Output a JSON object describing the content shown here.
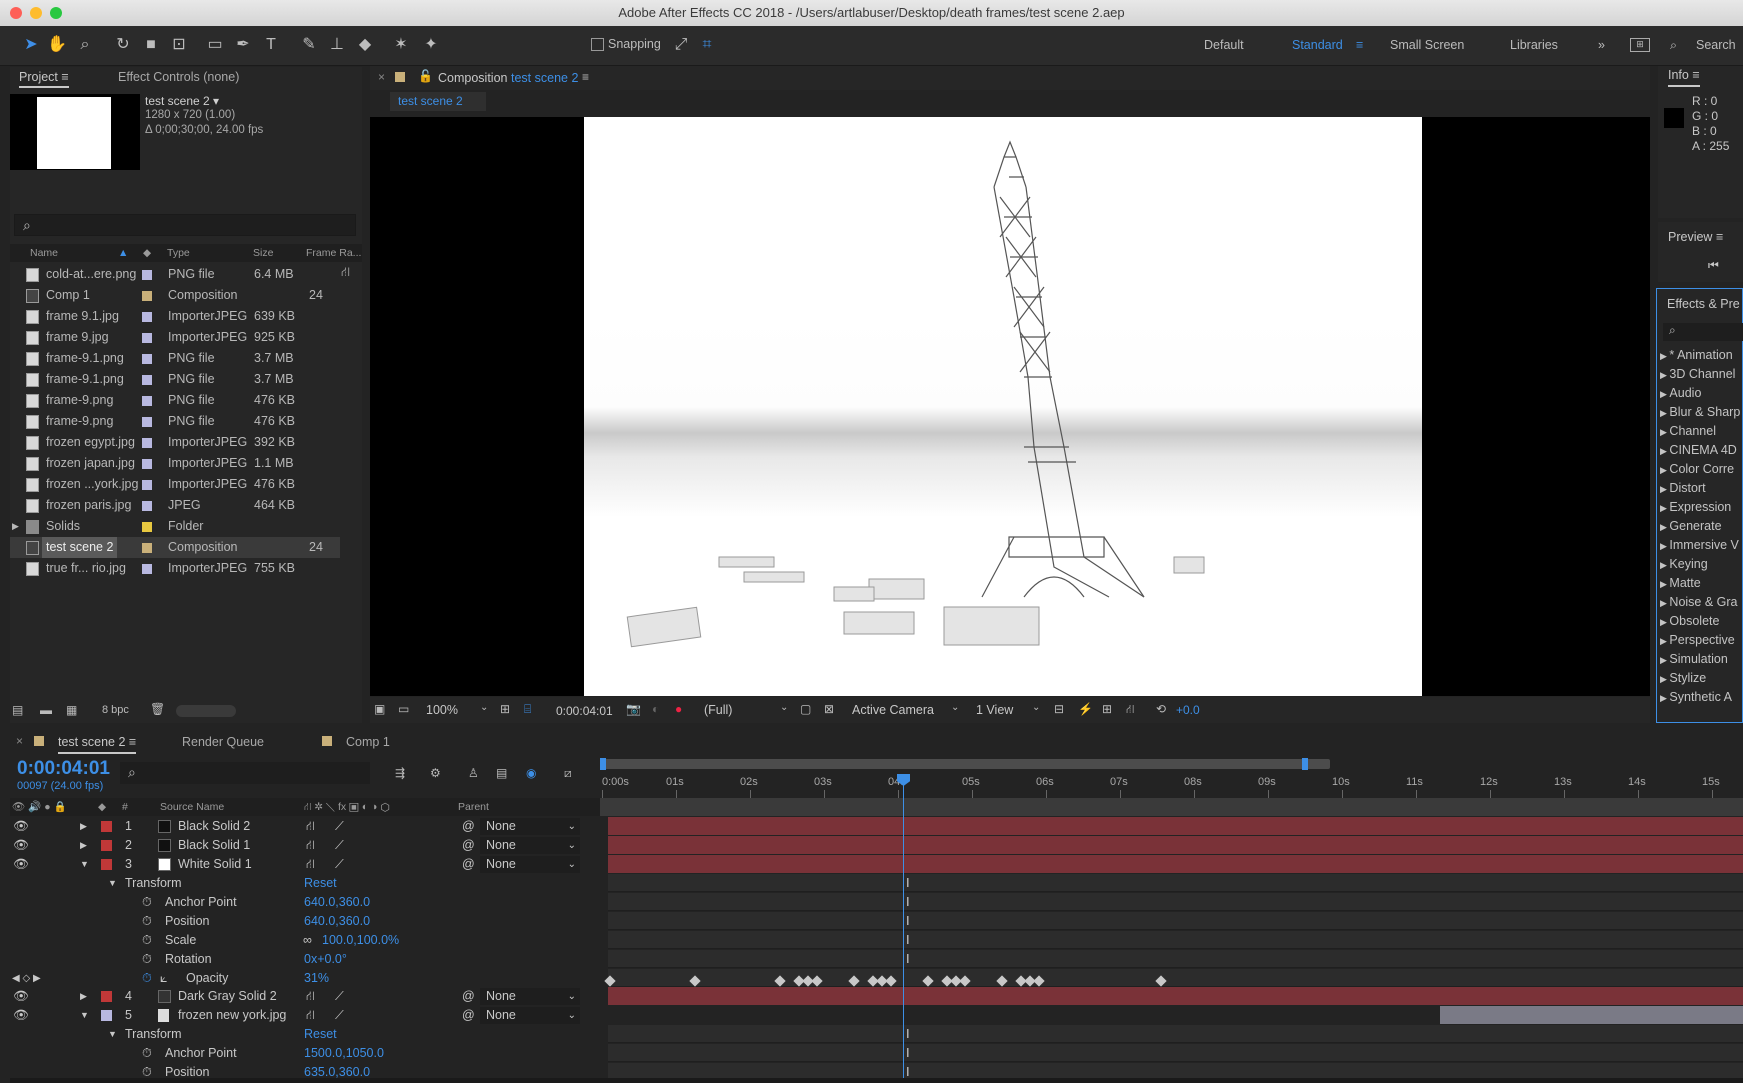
{
  "title": "Adobe After Effects CC 2018 - /Users/artlabuser/Desktop/death frames/test scene 2.aep",
  "toolbar": {
    "snapping": "Snapping",
    "workspaces": [
      "Default",
      "Standard",
      "Small Screen",
      "Libraries"
    ],
    "search": "Search",
    "more": "»"
  },
  "project": {
    "tab": "Project",
    "effect_controls": "Effect Controls (none)",
    "comp_name": "test scene 2 ▾",
    "comp_res": "1280 x 720 (1.00)",
    "comp_dur": "Δ 0;00;30;00, 24.00 fps",
    "headers": {
      "name": "Name",
      "type": "Type",
      "size": "Size",
      "frame": "Frame Ra..."
    },
    "items": [
      {
        "name": "cold-at...ere.png",
        "type": "PNG file",
        "size": "6.4 MB",
        "frame": ""
      },
      {
        "name": "Comp 1",
        "type": "Composition",
        "size": "",
        "frame": "24"
      },
      {
        "name": "frame 9.1.jpg",
        "type": "ImporterJPEG",
        "size": "639 KB",
        "frame": ""
      },
      {
        "name": "frame 9.jpg",
        "type": "ImporterJPEG",
        "size": "925 KB",
        "frame": ""
      },
      {
        "name": "frame-9.1.png",
        "type": "PNG file",
        "size": "3.7 MB",
        "frame": ""
      },
      {
        "name": "frame-9.1.png",
        "type": "PNG file",
        "size": "3.7 MB",
        "frame": ""
      },
      {
        "name": "frame-9.png",
        "type": "PNG file",
        "size": "476 KB",
        "frame": ""
      },
      {
        "name": "frame-9.png",
        "type": "PNG file",
        "size": "476 KB",
        "frame": ""
      },
      {
        "name": "frozen egypt.jpg",
        "type": "ImporterJPEG",
        "size": "392 KB",
        "frame": ""
      },
      {
        "name": "frozen japan.jpg",
        "type": "ImporterJPEG",
        "size": "1.1 MB",
        "frame": ""
      },
      {
        "name": "frozen ...york.jpg",
        "type": "ImporterJPEG",
        "size": "476 KB",
        "frame": ""
      },
      {
        "name": "frozen paris.jpg",
        "type": "JPEG",
        "size": "464 KB",
        "frame": ""
      },
      {
        "name": "Solids",
        "type": "Folder",
        "size": "",
        "frame": ""
      },
      {
        "name": "test scene 2",
        "type": "Composition",
        "size": "",
        "frame": "24"
      },
      {
        "name": "true fr... rio.jpg",
        "type": "ImporterJPEG",
        "size": "755 KB",
        "frame": ""
      }
    ],
    "bpc": "8 bpc"
  },
  "composition": {
    "tab_prefix": "Composition",
    "tab_name": "test scene 2",
    "sub_tab": "test scene 2",
    "footer": {
      "zoom": "100%",
      "time": "0:00:04:01",
      "resolution": "(Full)",
      "camera": "Active Camera",
      "views": "1 View",
      "exposure": "+0.0"
    }
  },
  "info": {
    "tab": "Info",
    "r": "R : 0",
    "g": "G : 0",
    "b": "B : 0",
    "a": "A : 255"
  },
  "preview": {
    "tab": "Preview"
  },
  "effects": {
    "tab": "Effects & Pre",
    "items": [
      "* Animation",
      "3D Channel",
      "Audio",
      "Blur & Sharp",
      "Channel",
      "CINEMA 4D",
      "Color Corre",
      "Distort",
      "Expression",
      "Generate",
      "Immersive V",
      "Keying",
      "Matte",
      "Noise & Gra",
      "Obsolete",
      "Perspective",
      "Simulation",
      "Stylize",
      "Synthetic A"
    ]
  },
  "timeline": {
    "tab": "test scene 2",
    "render_queue": "Render Queue",
    "comp1": "Comp 1",
    "time": "0:00:04:01",
    "frames": "00097 (24.00 fps)",
    "col_source": "Source Name",
    "col_parent": "Parent",
    "ruler": [
      "0:00s",
      "01s",
      "02s",
      "03s",
      "04s",
      "05s",
      "06s",
      "07s",
      "08s",
      "09s",
      "10s",
      "11s",
      "12s",
      "13s",
      "14s",
      "15s"
    ],
    "layers": [
      {
        "num": "1",
        "name": "Black Solid 2",
        "parent": "None",
        "swatch": "#111111"
      },
      {
        "num": "2",
        "name": "Black Solid 1",
        "parent": "None",
        "swatch": "#111111"
      },
      {
        "num": "3",
        "name": "White Solid 1",
        "parent": "None",
        "swatch": "#ffffff"
      },
      {
        "num": "4",
        "name": "Dark Gray Solid 2",
        "parent": "None",
        "swatch": "#333333"
      },
      {
        "num": "5",
        "name": "frozen new york.jpg",
        "parent": "None",
        "swatch": ""
      }
    ],
    "transform": "Transform",
    "reset": "Reset",
    "props": [
      {
        "name": "Anchor Point",
        "value": "640.0,360.0"
      },
      {
        "name": "Position",
        "value": "640.0,360.0"
      },
      {
        "name": "Scale",
        "value": "100.0,100.0%"
      },
      {
        "name": "Rotation",
        "value": "0x+0.0°"
      },
      {
        "name": "Opacity",
        "value": "31%"
      }
    ],
    "props5": [
      {
        "name": "Anchor Point",
        "value": "1500.0,1050.0"
      },
      {
        "name": "Position",
        "value": "635.0,360.0"
      }
    ],
    "opacity_keyframes_sec": [
      0,
      1.15,
      2.3,
      2.55,
      2.68,
      2.8,
      3.3,
      3.55,
      3.68,
      3.8,
      4.3,
      4.55,
      4.68,
      4.8,
      5.3,
      5.55,
      5.68,
      5.8,
      7.45
    ]
  },
  "colors": {
    "accent": "#3d8fe6",
    "layer_bar": "#7a3238",
    "bg": "#232323"
  }
}
